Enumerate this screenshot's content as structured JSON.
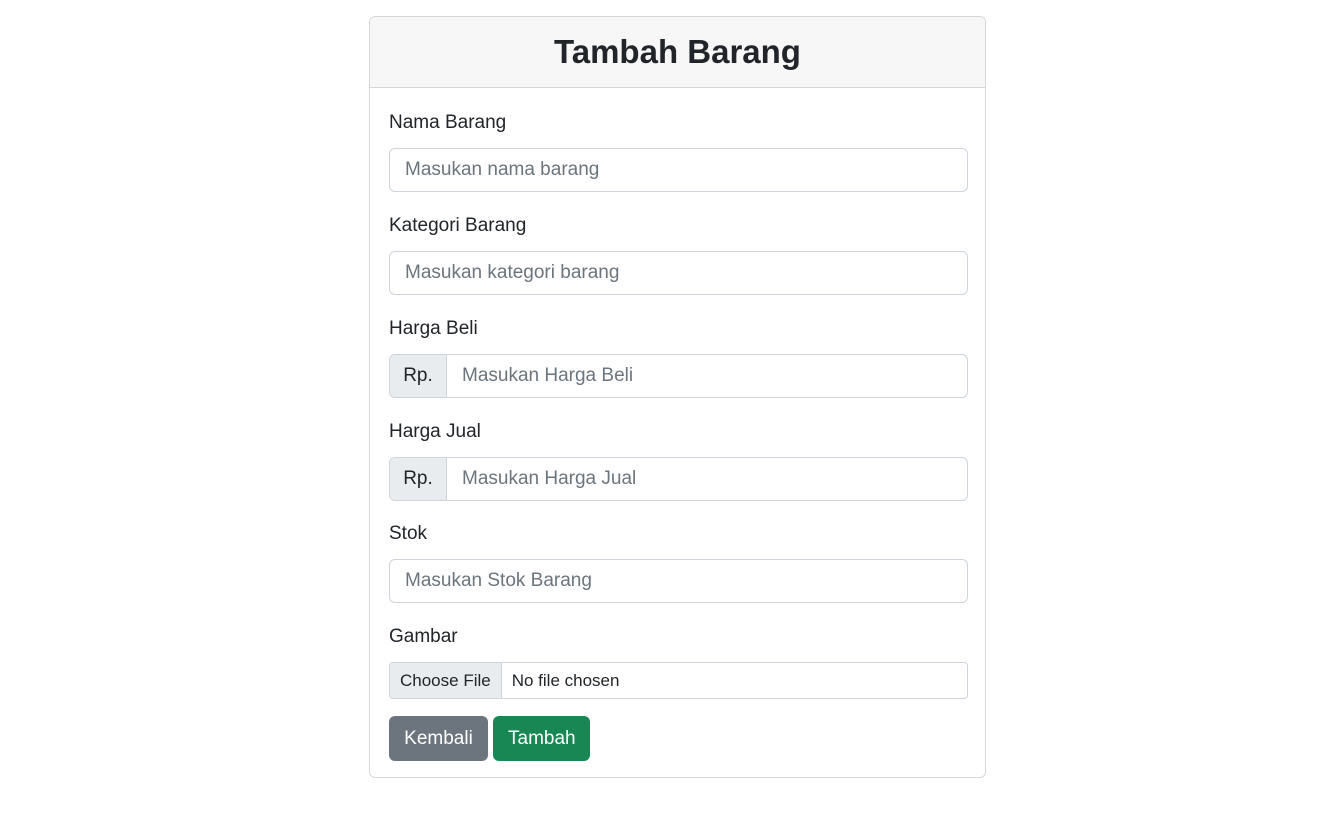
{
  "form": {
    "title": "Tambah Barang",
    "fields": {
      "nama": {
        "label": "Nama Barang",
        "placeholder": "Masukan nama barang"
      },
      "kategori": {
        "label": "Kategori Barang",
        "placeholder": "Masukan kategori barang"
      },
      "harga_beli": {
        "label": "Harga Beli",
        "prefix": "Rp.",
        "placeholder": "Masukan Harga Beli"
      },
      "harga_jual": {
        "label": "Harga Jual",
        "prefix": "Rp.",
        "placeholder": "Masukan Harga Jual"
      },
      "stok": {
        "label": "Stok",
        "placeholder": "Masukan Stok Barang"
      },
      "gambar": {
        "label": "Gambar",
        "button": "Choose File",
        "status": "No file chosen"
      }
    },
    "buttons": {
      "back": "Kembali",
      "submit": "Tambah"
    }
  },
  "colors": {
    "secondary": "#6c757d",
    "success": "#198754"
  }
}
